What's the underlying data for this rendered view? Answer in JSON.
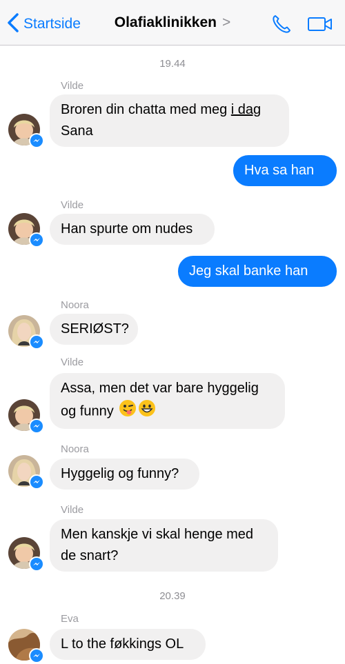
{
  "nav": {
    "back_label": "Startside",
    "title": "Olafiaklinikken",
    "title_chevron": ">"
  },
  "conversation": {
    "timestamps": [
      "19.44",
      "20.39"
    ],
    "senders": [
      "Vilde",
      "Vilde",
      "Noora",
      "Vilde",
      "Noora",
      "Vilde",
      "Eva"
    ],
    "messages": {
      "m1_line1_pre": "Broren din chatta med meg ",
      "m1_line1_link": "i dag",
      "m1_line2": "Sana",
      "m2": "Hva sa han",
      "m3": "Han spurte om nudes",
      "m4": "Jeg skal banke han",
      "m5": "SERIØST?",
      "m6_line1": "Assa, men det var bare hyggelig",
      "m6_line2": "og funny",
      "m7": "Hyggelig og funny?",
      "m8_line1": "Men kanskje vi skal henge med",
      "m8_line2": "de snart?",
      "m9": "L to the føkkings OL"
    },
    "emojis": [
      "winking-tongue-emoji",
      "grinning-emoji"
    ]
  },
  "colors": {
    "accent": "#0a7cff",
    "incoming_bubble": "#f1f0f0",
    "outgoing_bubble": "#0a7cff",
    "meta_text": "#8e8e93"
  }
}
